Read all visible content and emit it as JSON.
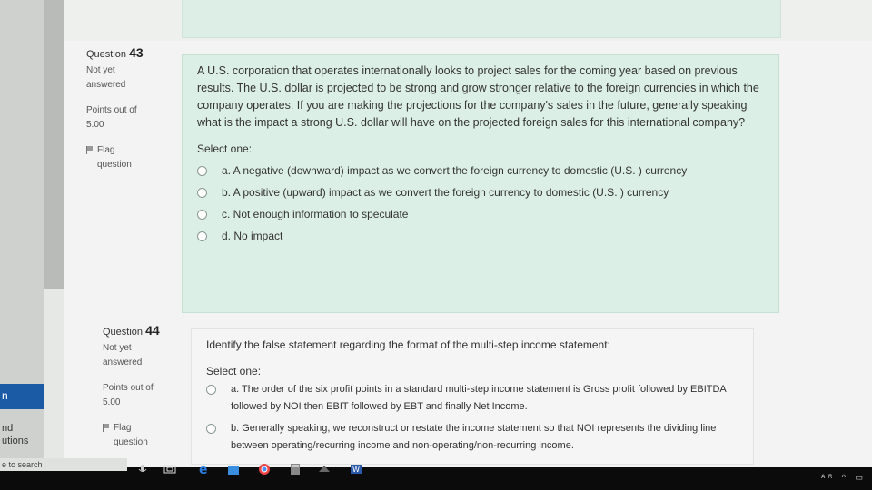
{
  "sidebar": {
    "active_item": "n",
    "items": [
      "nd",
      "utions"
    ],
    "search_placeholder": "e to search"
  },
  "questions": [
    {
      "label": "Question",
      "number": "43",
      "status": [
        "Not yet",
        "answered"
      ],
      "points": [
        "Points out of",
        "5.00"
      ],
      "flag": [
        "Flag",
        "question"
      ],
      "text": "A U.S. corporation that operates internationally looks to project sales for the coming year based on previous results. The U.S. dollar is projected to be strong and grow stronger relative to the foreign currencies in which the company operates. If you are making the projections for the company's sales in the future, generally speaking what is the impact a strong U.S. dollar will have on the projected foreign sales for this international company?",
      "select_one": "Select one:",
      "answers": [
        "a. A negative (downward) impact as we convert the foreign currency to domestic (U.S. ) currency",
        "b. A positive (upward) impact as we convert the foreign currency to domestic (U.S. ) currency",
        "c. Not enough information to speculate",
        "d. No impact"
      ]
    },
    {
      "label": "Question",
      "number": "44",
      "status": [
        "Not yet",
        "answered"
      ],
      "points": [
        "Points out of",
        "5.00"
      ],
      "flag": [
        "Flag",
        "question"
      ],
      "text": "Identify the false statement regarding the format of the multi-step income statement:",
      "select_one": "Select one:",
      "answers": [
        "a. The order of the six profit points in a standard multi-step income statement is Gross profit followed by EBITDA followed by NOI then EBIT followed by EBT and finally Net Income.",
        "b. Generally speaking, we reconstruct or restate the income statement so that NOI represents the dividing line between operating/recurring income and non-operating/non-recurring income."
      ]
    }
  ],
  "taskbar": {
    "tray_text": "ᴬᴿ ^ ▭",
    "icons": [
      "mic-icon",
      "task-view-icon",
      "edge-icon",
      "store-icon",
      "chrome-icon",
      "calculator-icon",
      "app-icon",
      "word-icon"
    ]
  }
}
